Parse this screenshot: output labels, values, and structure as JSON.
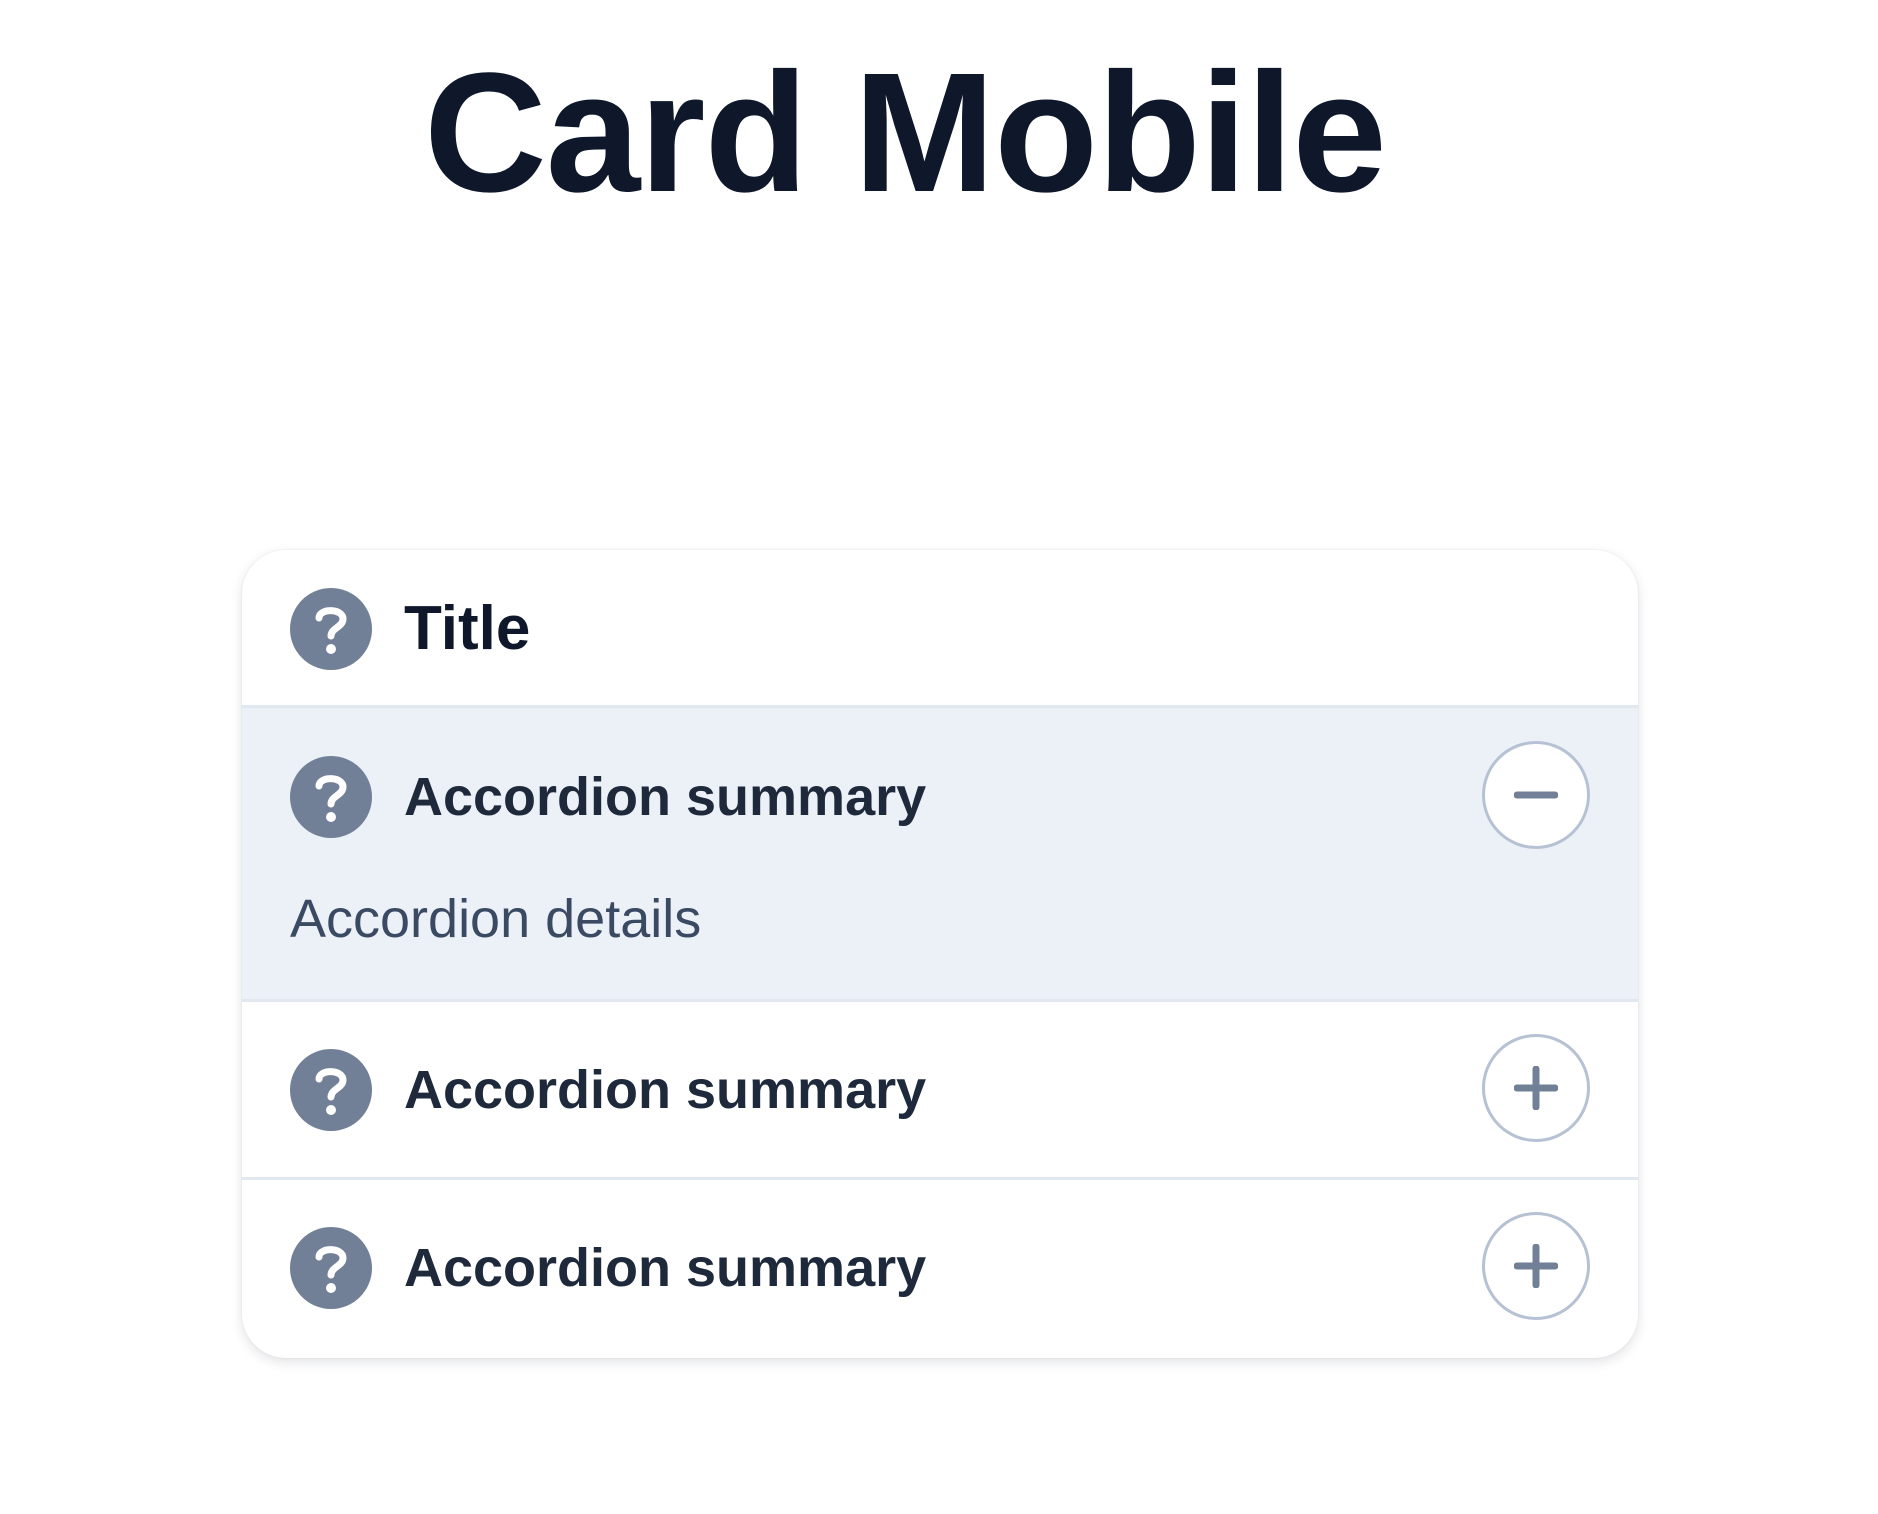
{
  "page": {
    "title": "Card Mobile"
  },
  "card": {
    "header": {
      "icon": "help-circle-icon",
      "title": "Title"
    },
    "accordions": [
      {
        "summary": "Accordion summary",
        "details": "Accordion details",
        "expanded": true,
        "icon": "help-circle-icon",
        "toggle_icon": "minus-icon"
      },
      {
        "summary": "Accordion summary",
        "expanded": false,
        "icon": "help-circle-icon",
        "toggle_icon": "plus-icon"
      },
      {
        "summary": "Accordion summary",
        "expanded": false,
        "icon": "help-circle-icon",
        "toggle_icon": "plus-icon"
      }
    ]
  },
  "colors": {
    "heading_text": "#0f172a",
    "summary_text": "#1e293b",
    "details_text": "#3b4a63",
    "icon_background": "#718096",
    "expanded_background": "#ecf1f8",
    "divider": "#e2e8f0",
    "toggle_border": "#b6c2d3",
    "toggle_glyph": "#718096"
  }
}
